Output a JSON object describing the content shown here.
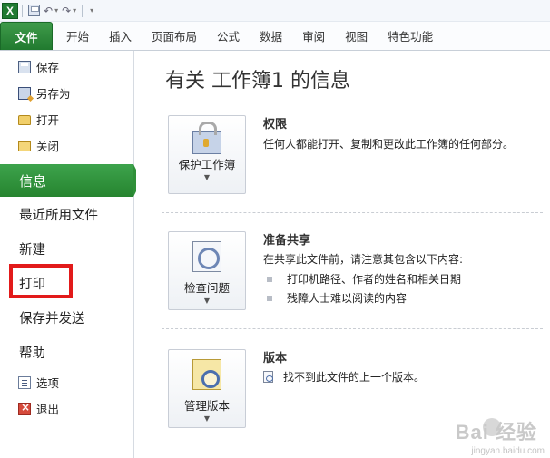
{
  "quick_access": {
    "app_icon": "X",
    "save_icon": "save-icon",
    "undo_icon": "undo-icon",
    "redo_icon": "redo-icon",
    "customize_icon": "chevron-down-icon"
  },
  "ribbon_tabs": [
    "文件",
    "开始",
    "插入",
    "页面布局",
    "公式",
    "数据",
    "审阅",
    "视图",
    "特色功能"
  ],
  "nav": {
    "items_top": [
      {
        "label": "保存",
        "icon": "save-icon"
      },
      {
        "label": "另存为",
        "icon": "save-as-icon"
      },
      {
        "label": "打开",
        "icon": "open-folder-icon"
      },
      {
        "label": "关闭",
        "icon": "close-folder-icon"
      }
    ],
    "active": "信息",
    "items_large": [
      "最近所用文件",
      "新建",
      "打印",
      "保存并发送",
      "帮助"
    ],
    "items_bottom": [
      {
        "label": "选项",
        "icon": "options-icon"
      },
      {
        "label": "退出",
        "icon": "exit-icon"
      }
    ]
  },
  "main": {
    "title": "有关 工作簿1 的信息",
    "sections": [
      {
        "button_label": "保护工作簿",
        "button_icon": "lock-icon",
        "heading": "权限",
        "body": "任何人都能打开、复制和更改此工作簿的任何部分。"
      },
      {
        "button_label": "检查问题",
        "button_icon": "inspect-document-icon",
        "heading": "准备共享",
        "body": "在共享此文件前，请注意其包含以下内容:",
        "bullets": [
          "打印机路径、作者的姓名和相关日期",
          "残障人士难以阅读的内容"
        ]
      },
      {
        "button_label": "管理版本",
        "button_icon": "manage-versions-icon",
        "heading": "版本",
        "body": "找不到此文件的上一个版本。",
        "body_icon": "document-version-icon"
      }
    ]
  },
  "watermark": {
    "logo": "Bai  经验",
    "url": "jingyan.baidu.com"
  },
  "colors": {
    "accent_green": "#2f9039",
    "highlight_red": "#e21a1a"
  }
}
